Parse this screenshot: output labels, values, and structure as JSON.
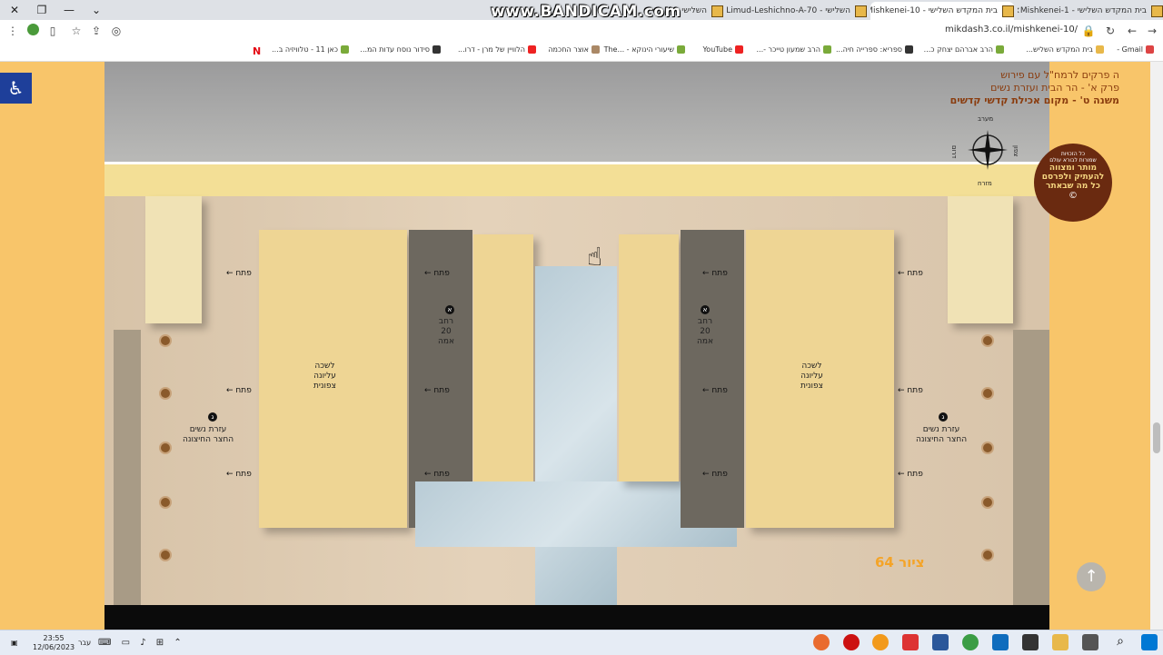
{
  "browser": {
    "tabs": [
      {
        "label": "בית המקדש השלישי - Mishkenei-1",
        "active": false
      },
      {
        "label": "בית המקדש השלישי - Mishkenei-10",
        "active": true
      },
      {
        "label": "השלישי - Limud-Leshichno-A-70",
        "active": false
      },
      {
        "label": "השלישי",
        "active": false
      }
    ],
    "recorder_watermark": "www.BANDICAM.com",
    "url": "mikdash3.co.il/mishkenei-10/",
    "bookmarks": [
      "Gmail -",
      "בית המקדש השליש...",
      "הרב אברהם יצחק כ...",
      "ספריא: ספרייה חיה...",
      "הרב שמעון טייכר -...",
      "YouTube",
      "שיעורי הינוקא - ...The",
      "אוצר החכמה",
      "הלוויין של מרן - דרו...",
      "סידור נוסח עדות המ...",
      "כאן 11 - טלוויזיה ב..."
    ]
  },
  "page": {
    "title_line1": "ה פרקים לרמח\"ל עם פירוש",
    "title_line2": "פרק א' - הר הבית ועזרת נשים",
    "title_line3": "משנה ט' - מקום אכילת קדשי קדשים",
    "compass": {
      "north": "מערב",
      "south": "מזרח",
      "east": "צפון",
      "west": "דרום"
    },
    "copyright": {
      "line1": "כל הזכויות",
      "line2": "שמורות לבורא עולם",
      "line3": "מותר ומצווה",
      "line4": "להעתיק ולפרסם",
      "line5": "כל מה שבאתר",
      "symbol": "©"
    },
    "diagram": {
      "chamber_left": "לשכה\nעליונה\nצפונית",
      "chamber_right": "לשכה\nעליונה\nצפונית",
      "women_court": "עזרת נשים\nהחצר החיצונה",
      "width_note": "רחב\n20\nאמה",
      "door": "פתח",
      "marker_a": "א",
      "marker_g": "ג"
    },
    "figure_label": "ציור 64",
    "scroll_up": "↑"
  },
  "taskbar": {
    "time": "23:55",
    "date": "12/06/2023",
    "lang": "עבר"
  }
}
